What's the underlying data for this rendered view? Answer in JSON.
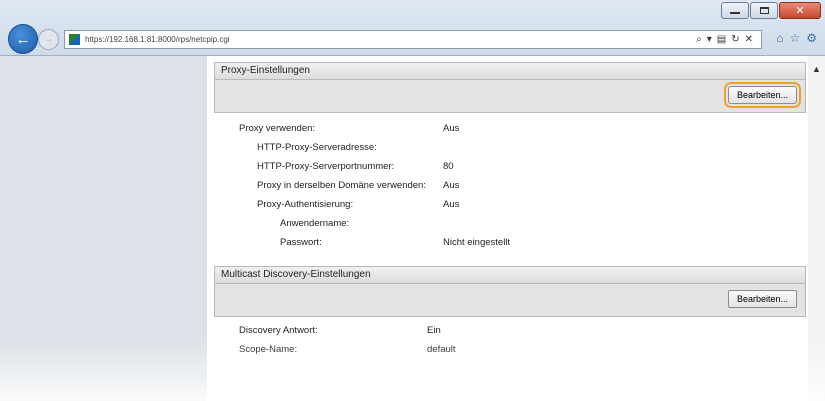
{
  "browser": {
    "url": "https://192.168.1.81:8000/rps/netcpip.cgi",
    "toolbar_icons": [
      "search-icon",
      "dropdown-icon",
      "compat-icon",
      "refresh-icon",
      "stop-icon"
    ],
    "right_icons": [
      "home-icon",
      "favorites-icon",
      "settings-icon"
    ]
  },
  "proxy": {
    "title": "Proxy-Einstellungen",
    "edit_label": "Bearbeiten...",
    "rows": [
      {
        "label": "Proxy verwenden:",
        "value": "Aus"
      },
      {
        "label": "HTTP-Proxy-Serveradresse:",
        "value": ""
      },
      {
        "label": "HTTP-Proxy-Serverportnummer:",
        "value": "80"
      },
      {
        "label": "Proxy in derselben Domäne verwenden:",
        "value": "Aus"
      },
      {
        "label": "Proxy-Authentisierung:",
        "value": "Aus"
      },
      {
        "label": "Anwendername:",
        "value": ""
      },
      {
        "label": "Passwort:",
        "value": "Nicht eingestellt"
      }
    ]
  },
  "multicast": {
    "title": "Multicast Discovery-Einstellungen",
    "edit_label": "Bearbeiten...",
    "rows": [
      {
        "label": "Discovery Antwort:",
        "value": "Ein"
      },
      {
        "label": "Scope-Name:",
        "value": "default"
      }
    ]
  },
  "colors": {
    "highlight": "#f0a030",
    "back_button": "#1a5ba8"
  }
}
